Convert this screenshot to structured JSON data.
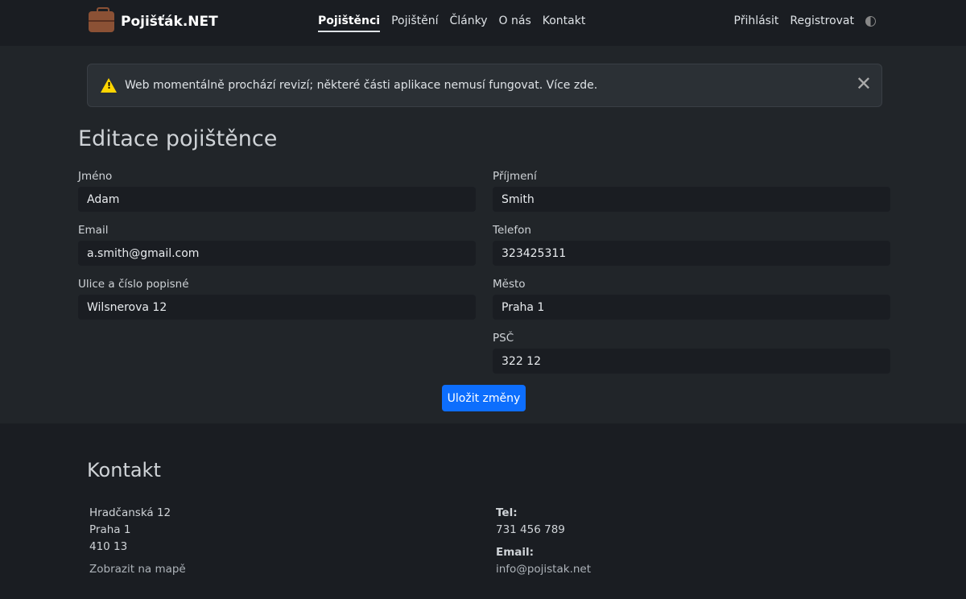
{
  "nav": {
    "brand": "Pojišťák.NET",
    "links": [
      "Pojištěnci",
      "Pojištění",
      "Články",
      "O nás",
      "Kontakt"
    ],
    "login": "Přihlásit",
    "register": "Registrovat"
  },
  "alert": {
    "text": "Web momentálně prochází revizí; některé části aplikace nemusí fungovat. ",
    "link": "Více zde",
    "end": "."
  },
  "title": "Editace pojištěnce",
  "form": {
    "first_name": {
      "label": "Jméno",
      "value": "Adam"
    },
    "last_name": {
      "label": "Příjmení",
      "value": "Smith"
    },
    "email": {
      "label": "Email",
      "value": "a.smith@gmail.com"
    },
    "phone": {
      "label": "Telefon",
      "value": "323425311"
    },
    "street": {
      "label": "Ulice a číslo popisné",
      "value": "Wilsnerova 12"
    },
    "city": {
      "label": "Město",
      "value": "Praha 1"
    },
    "zip": {
      "label": "PSČ",
      "value": "322 12"
    },
    "save": "Uložit změny"
  },
  "footer": {
    "title": "Kontakt",
    "address": [
      "Hradčanská 12",
      "Praha 1",
      "410 13"
    ],
    "map_link": "Zobrazit na mapě",
    "tel_label": "Tel:",
    "tel": "731 456 789",
    "email_label": "Email:",
    "email": "info@pojistak.net"
  }
}
